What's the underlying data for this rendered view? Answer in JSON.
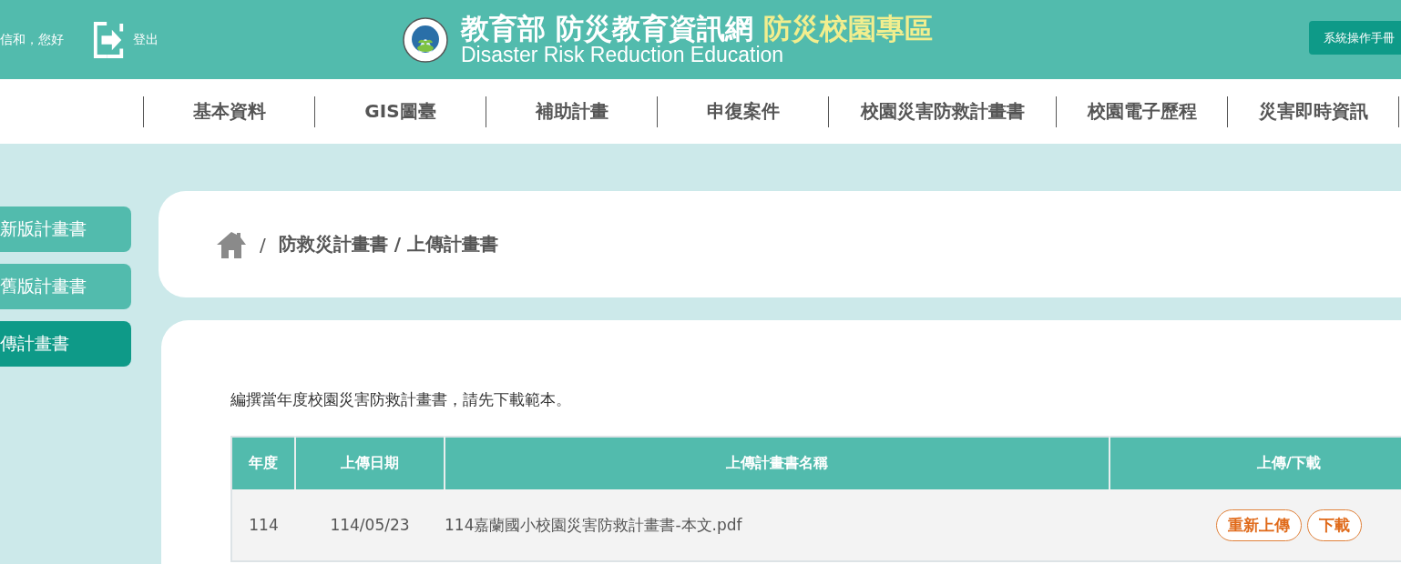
{
  "header": {
    "greeting": "信和，您好",
    "logout": "登出",
    "title_main": "教育部 防災教育資訊網",
    "title_zone": "防災校園專區",
    "subtitle": "Disaster Risk Reduction Education",
    "manual_button": "系統操作手冊"
  },
  "nav": [
    {
      "label": "基本資料"
    },
    {
      "label": "GIS圖臺"
    },
    {
      "label": "補助計畫"
    },
    {
      "label": "申復案件"
    },
    {
      "label": "校園災害防救計畫書"
    },
    {
      "label": "校園電子歷程"
    },
    {
      "label": "災害即時資訊"
    }
  ],
  "sidebar": [
    {
      "label": "新版計畫書",
      "selected": false
    },
    {
      "label": "舊版計畫書",
      "selected": false
    },
    {
      "label": "傳計畫書",
      "selected": true
    }
  ],
  "breadcrumb": {
    "separator": "/",
    "path": "防救災計畫書 / 上傳計畫書"
  },
  "intro": "編撰當年度校園災害防救計畫書，請先下載範本。",
  "table": {
    "columns": [
      "年度",
      "上傳日期",
      "上傳計畫書名稱",
      "上傳/下載"
    ],
    "rows": [
      {
        "year": "114",
        "date": "114/05/23",
        "name": "114嘉蘭國小校園災害防救計畫書-本文.pdf",
        "actions": [
          "重新上傳",
          "下載"
        ]
      }
    ]
  }
}
